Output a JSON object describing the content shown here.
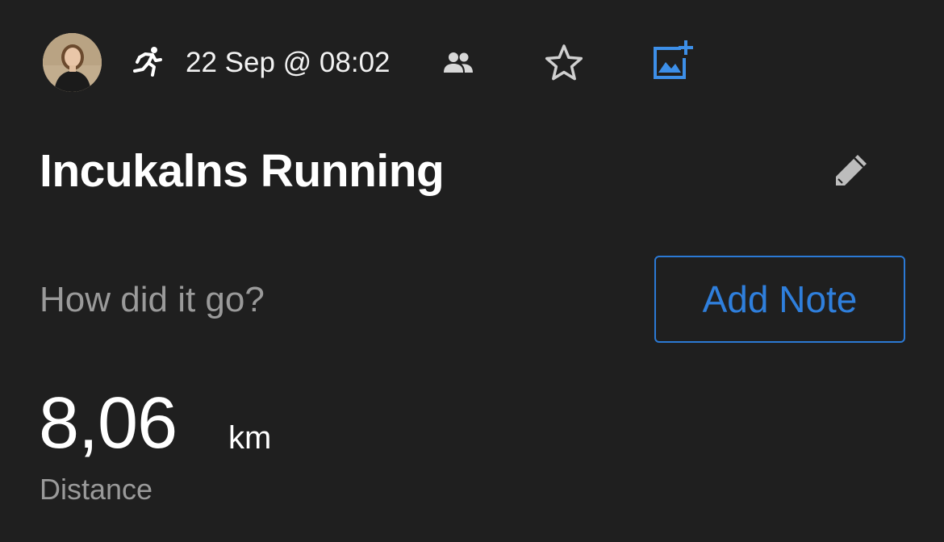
{
  "header": {
    "avatar_icon": "user-avatar",
    "activity_icon": "running-icon",
    "datetime": "22 Sep @ 08:02",
    "people_icon": "people-icon",
    "favorite_icon": "star-outline-icon",
    "add_photo_icon": "add-photo-icon"
  },
  "workout": {
    "title": "Incukalns Running",
    "edit_icon": "pencil-icon"
  },
  "note": {
    "prompt": "How did it go?",
    "button_label": "Add Note"
  },
  "stats": {
    "distance_value": "8,06",
    "distance_unit": "km",
    "distance_label": "Distance"
  },
  "colors": {
    "background": "#1f1f1f",
    "accent": "#2f7fdc",
    "muted_text": "#9a9a9a",
    "primary_text": "#ffffff"
  }
}
